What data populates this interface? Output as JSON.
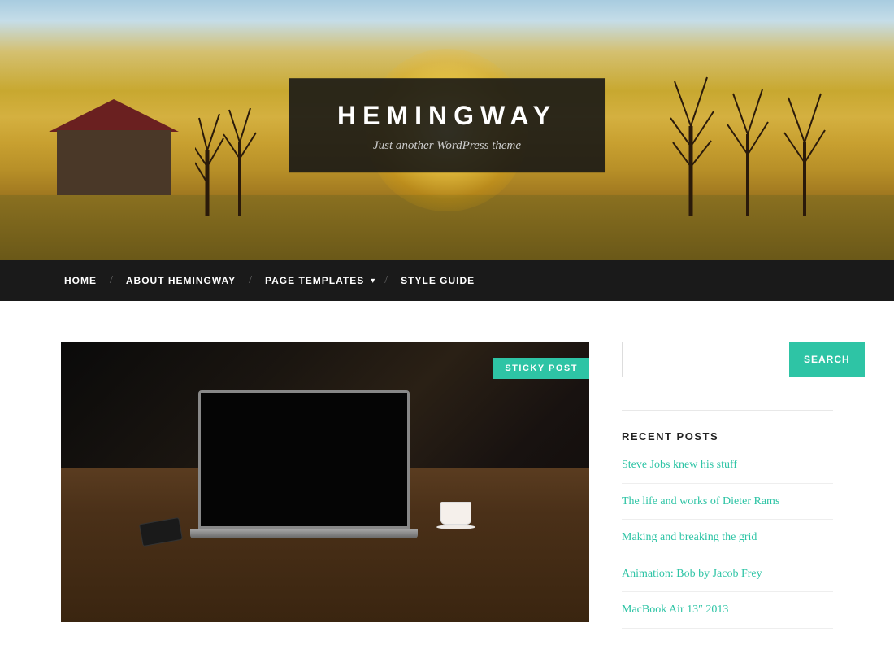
{
  "site": {
    "title": "HEMINGWAY",
    "tagline": "Just another WordPress theme"
  },
  "nav": {
    "items": [
      {
        "label": "HOME",
        "active": true
      },
      {
        "label": "ABOUT HEMINGWAY",
        "active": false
      },
      {
        "label": "PAGE TEMPLATES",
        "active": false,
        "has_dropdown": true
      },
      {
        "label": "STYLE GUIDE",
        "active": false
      }
    ]
  },
  "sticky_badge": "STICKY POST",
  "search": {
    "placeholder": "",
    "button_label": "SEARCH"
  },
  "sidebar": {
    "recent_posts_title": "RECENT POSTS",
    "posts": [
      {
        "title": "Steve Jobs knew his stuff"
      },
      {
        "title": "The life and works of Dieter Rams"
      },
      {
        "title": "Making and breaking the grid"
      },
      {
        "title": "Animation: Bob by Jacob Frey"
      },
      {
        "title": "MacBook Air 13″ 2013"
      }
    ]
  }
}
